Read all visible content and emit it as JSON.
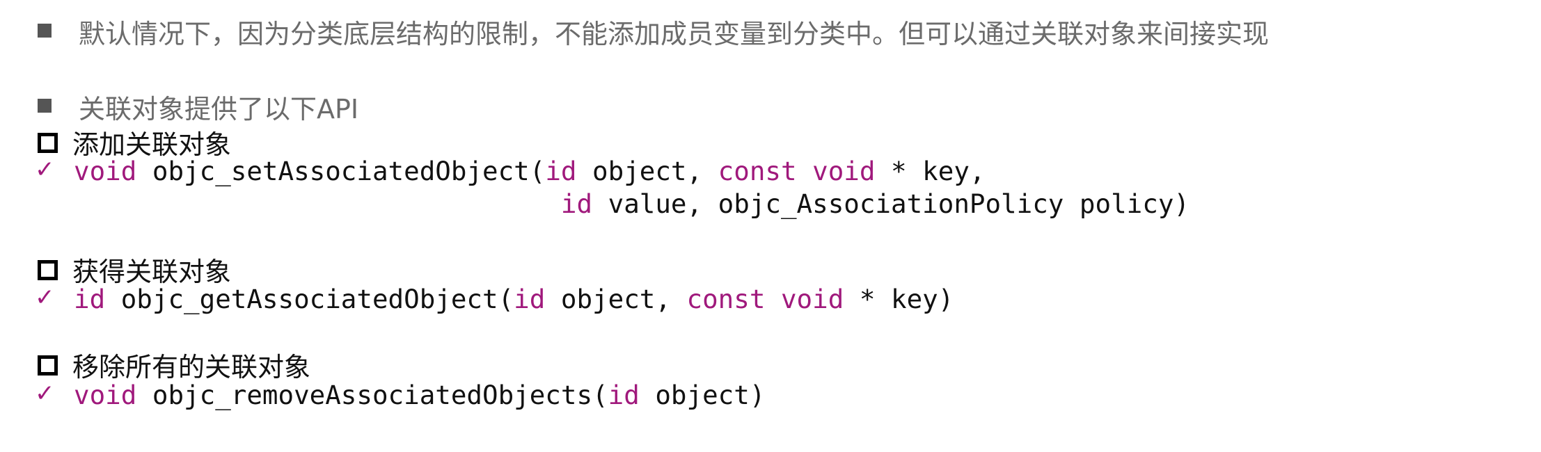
{
  "intro": {
    "text": "默认情况下，因为分类底层结构的限制，不能添加成员变量到分类中。但可以通过关联对象来间接实现"
  },
  "api_intro": {
    "text": "关联对象提供了以下API"
  },
  "sections": [
    {
      "heading": "添加关联对象",
      "code_lines": [
        [
          {
            "t": "void",
            "kw": true
          },
          {
            "t": " objc_setAssociatedObject(",
            "kw": false
          },
          {
            "t": "id",
            "kw": true
          },
          {
            "t": " object, ",
            "kw": false
          },
          {
            "t": "const",
            "kw": true
          },
          {
            "t": " ",
            "kw": false
          },
          {
            "t": "void",
            "kw": true
          },
          {
            "t": " * key,",
            "kw": false
          }
        ],
        [
          {
            "t": "                               ",
            "kw": false
          },
          {
            "t": "id",
            "kw": true
          },
          {
            "t": " value, objc_AssociationPolicy policy)",
            "kw": false
          }
        ]
      ]
    },
    {
      "heading": "获得关联对象",
      "code_lines": [
        [
          {
            "t": "id",
            "kw": true
          },
          {
            "t": " objc_getAssociatedObject(",
            "kw": false
          },
          {
            "t": "id",
            "kw": true
          },
          {
            "t": " object, ",
            "kw": false
          },
          {
            "t": "const",
            "kw": true
          },
          {
            "t": " ",
            "kw": false
          },
          {
            "t": "void",
            "kw": true
          },
          {
            "t": " * key)",
            "kw": false
          }
        ]
      ]
    },
    {
      "heading": "移除所有的关联对象",
      "code_lines": [
        [
          {
            "t": "void",
            "kw": true
          },
          {
            "t": " objc_removeAssociatedObjects(",
            "kw": false
          },
          {
            "t": "id",
            "kw": true
          },
          {
            "t": " object)",
            "kw": false
          }
        ]
      ]
    }
  ],
  "icons": {
    "filled_bullet": "filled-square-bullet-icon",
    "hollow_bullet": "hollow-square-bullet-icon",
    "check": "checkmark-icon",
    "check_glyph": "✓"
  },
  "colors": {
    "keyword": "#a0197c",
    "gray_text": "#6b6b6b",
    "text": "#111111"
  }
}
